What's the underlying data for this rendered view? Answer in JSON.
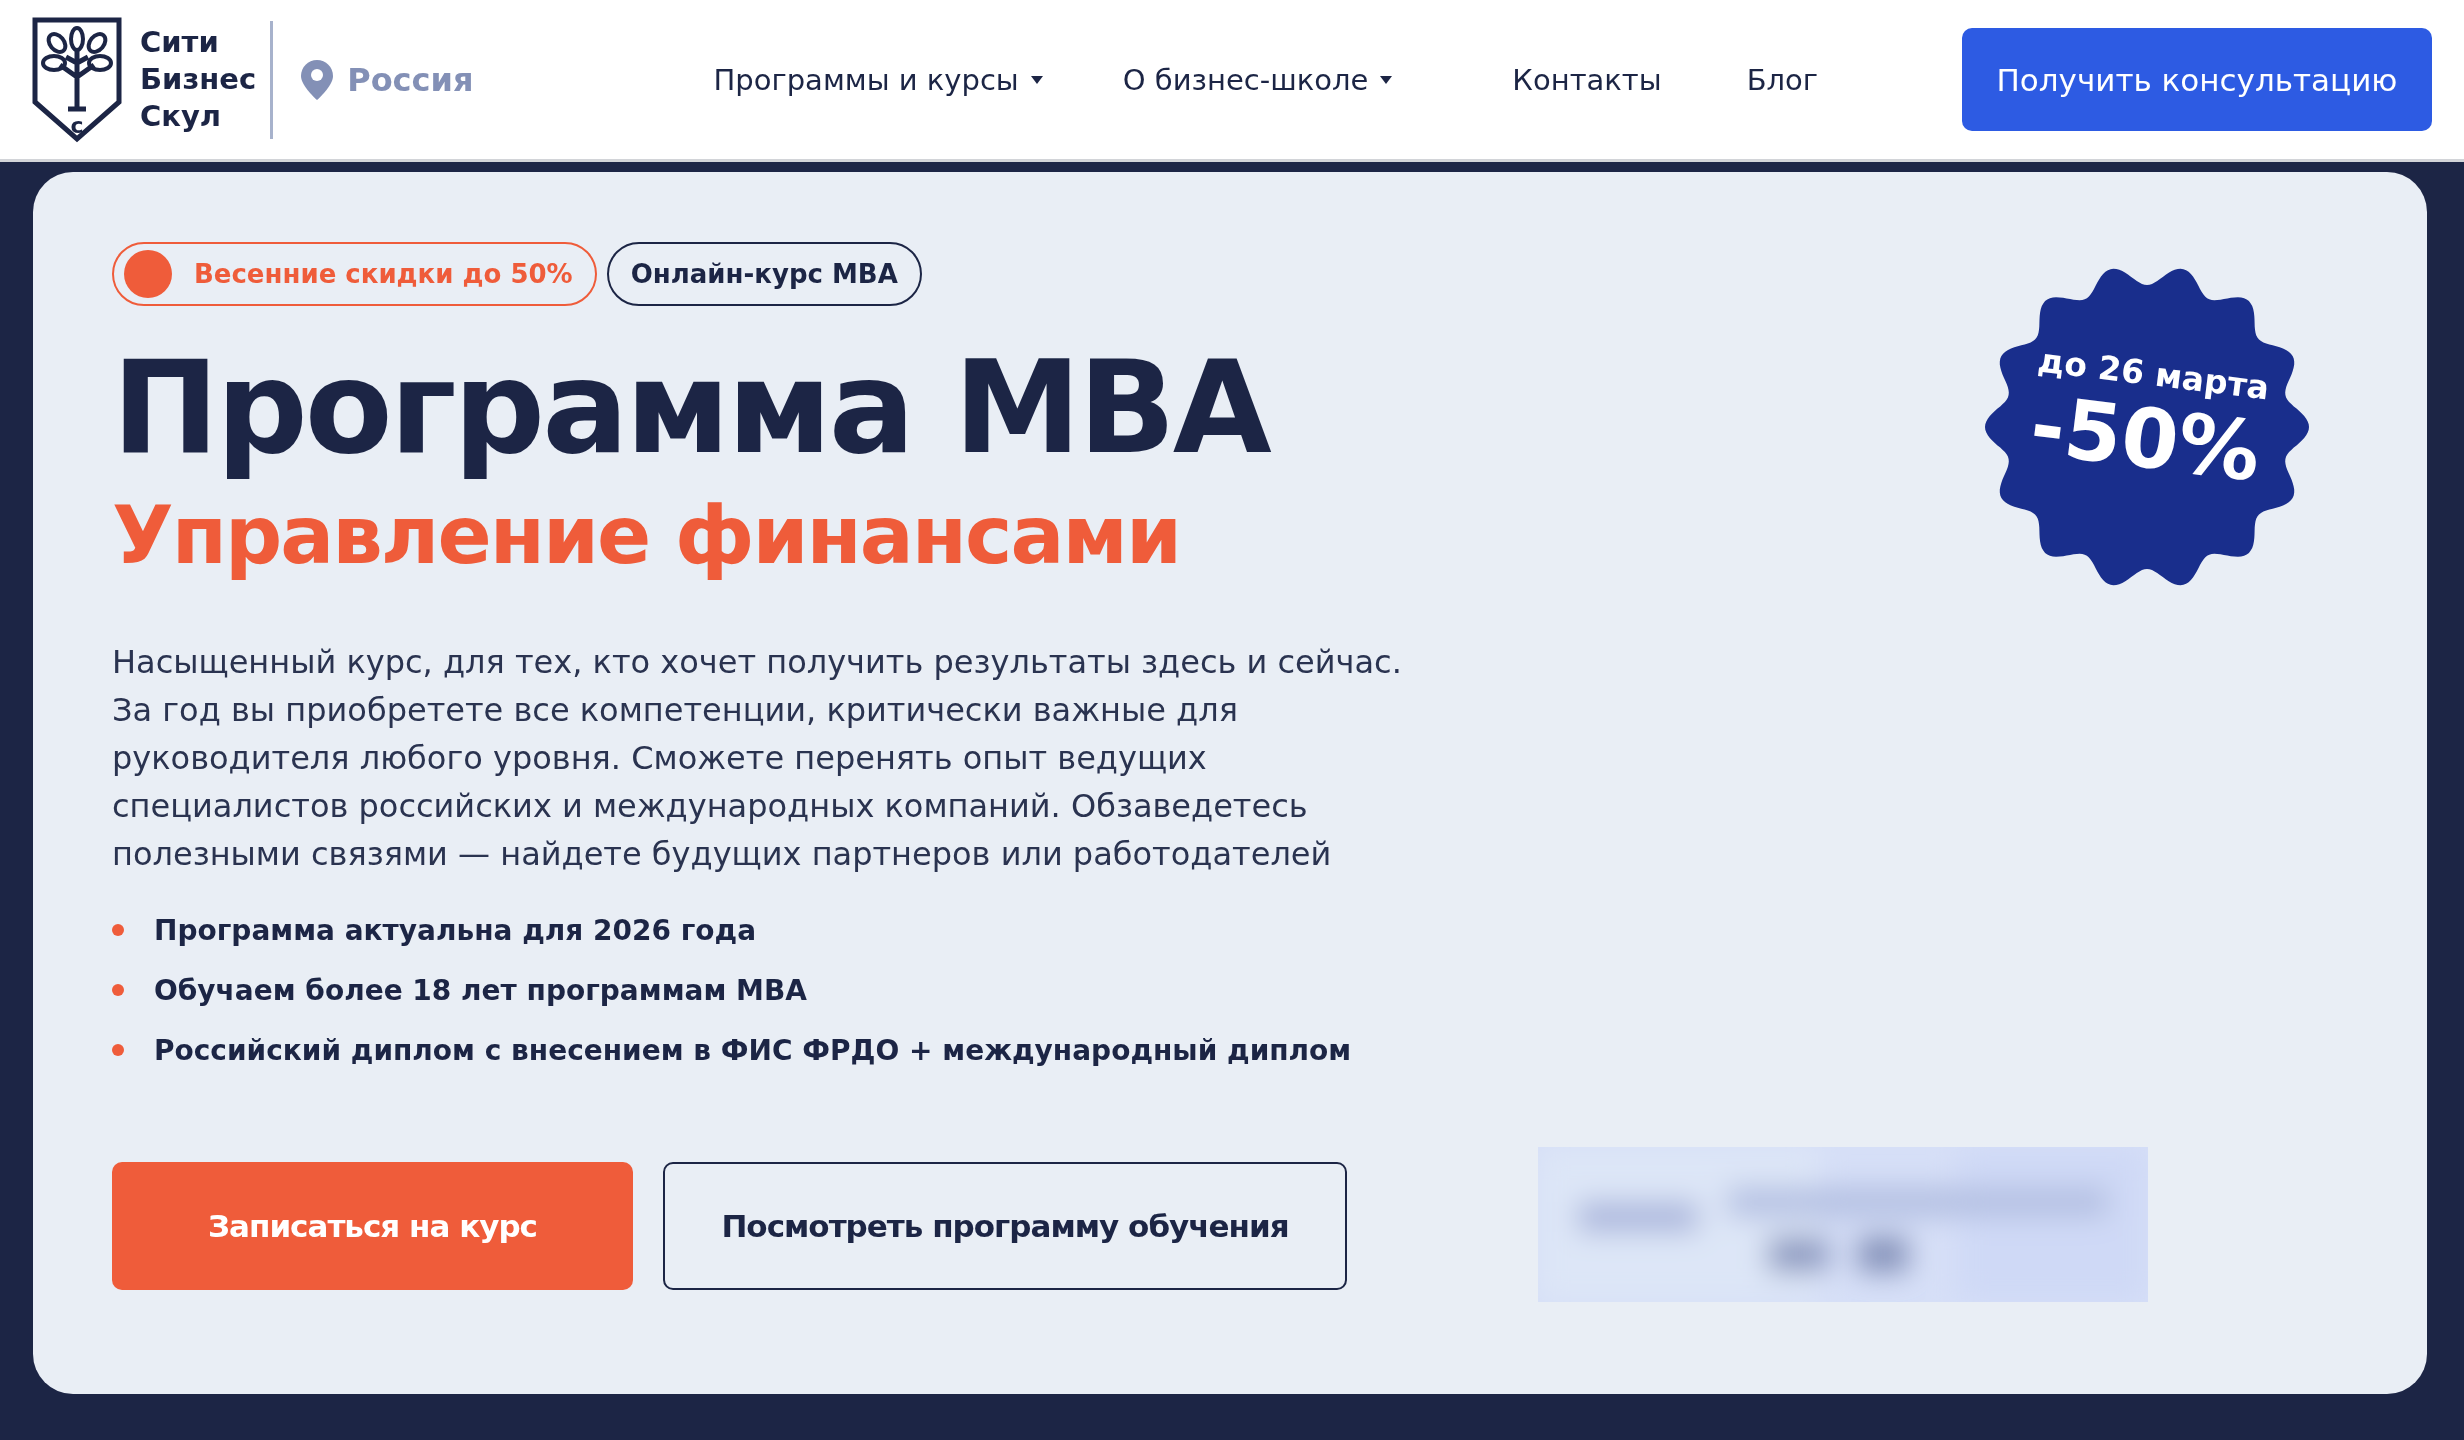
{
  "logo": {
    "lines": [
      "Сити",
      "Бизнес",
      "Скул"
    ],
    "emblem_letter": "с"
  },
  "location": "Россия",
  "nav": [
    {
      "label": "Программы и курсы",
      "dropdown": true
    },
    {
      "label": "О бизнес-школе",
      "dropdown": true
    },
    {
      "label": "Контакты",
      "dropdown": false
    },
    {
      "label": "Блог",
      "dropdown": false
    }
  ],
  "cta": "Получить консультацию",
  "tags": [
    {
      "kind": "promo",
      "label": "Весенние скидки до 50%"
    },
    {
      "kind": "outline",
      "label": "Онлайн-курс MBA"
    }
  ],
  "title": "Программа MBA",
  "subtitle": "Управление финансами",
  "description": "Насыщенный курс, для тех, кто хочет получить результаты здесь и сейчас. За год вы приобретете все компетенции, критически важные для руководителя любого уровня. Сможете перенять опыт ведущих специалистов российских и международных компаний. Обзаведетесь полезными связями — найдете будущих партнеров или работодателей",
  "bullets": [
    "Программа актуальна для 2026 года",
    "Обучаем более 18 лет программам MBA",
    "Российский диплом с внесением в ФИС ФРДО + международный диплом"
  ],
  "buttons": [
    {
      "kind": "primary",
      "label": "Записаться на курс"
    },
    {
      "kind": "outline",
      "label": "Посмотреть программу обучения"
    }
  ],
  "sticker": {
    "date": "до 26 марта",
    "discount": "-50%"
  },
  "blurred": {
    "kind": "picture"
  }
}
